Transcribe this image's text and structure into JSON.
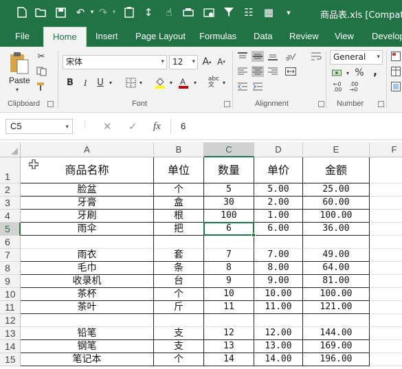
{
  "app": {
    "title": "商品表.xls [Compatibi",
    "accent": "#217346"
  },
  "qat_icons": [
    "new-icon",
    "save-icon",
    "undo-icon",
    "redo-icon",
    "paste-values-icon",
    "format-painter-icon",
    "sort-icon",
    "filter-icon",
    "list-icon",
    "grid-icon",
    "more-icon"
  ],
  "tabs": [
    "File",
    "Home",
    "Insert",
    "Page Layout",
    "Formulas",
    "Data",
    "Review",
    "View",
    "Develop"
  ],
  "ribbon": {
    "clipboard": {
      "label": "Clipboard",
      "paste": "Paste"
    },
    "font": {
      "label": "Font",
      "name": "宋体",
      "size": "12",
      "bold": "B",
      "italic": "I",
      "underline": "U",
      "grow": "A",
      "shrink": "A"
    },
    "alignment": {
      "label": "Alignment"
    },
    "number": {
      "label": "Number",
      "format": "General",
      "percent": "%",
      "comma": ","
    }
  },
  "formula_bar": {
    "name_box": "C5",
    "fx": "fx",
    "cancel": "✕",
    "enter": "✓",
    "value": "6"
  },
  "columns": [
    "A",
    "B",
    "C",
    "D",
    "E",
    "F"
  ],
  "headers": {
    "a": "商品名称",
    "b": "单位",
    "c": "数量",
    "d": "单价",
    "e": "金额"
  },
  "rows": [
    {
      "n": "1"
    },
    {
      "n": "2",
      "a": "脸盆",
      "b": "个",
      "c": "5",
      "d": "5.00",
      "e": "25.00"
    },
    {
      "n": "3",
      "a": "牙膏",
      "b": "盒",
      "c": "30",
      "d": "2.00",
      "e": "60.00"
    },
    {
      "n": "4",
      "a": "牙刷",
      "b": "根",
      "c": "100",
      "d": "1.00",
      "e": "100.00"
    },
    {
      "n": "5",
      "a": "雨伞",
      "b": "把",
      "c": "6",
      "d": "6.00",
      "e": "36.00"
    },
    {
      "n": "6",
      "a": "",
      "b": "",
      "c": "",
      "d": "",
      "e": ""
    },
    {
      "n": "7",
      "a": "雨衣",
      "b": "套",
      "c": "7",
      "d": "7.00",
      "e": "49.00"
    },
    {
      "n": "8",
      "a": "毛巾",
      "b": "条",
      "c": "8",
      "d": "8.00",
      "e": "64.00"
    },
    {
      "n": "9",
      "a": "收录机",
      "b": "台",
      "c": "9",
      "d": "9.00",
      "e": "81.00"
    },
    {
      "n": "10",
      "a": "茶杯",
      "b": "个",
      "c": "10",
      "d": "10.00",
      "e": "100.00"
    },
    {
      "n": "11",
      "a": "茶叶",
      "b": "斤",
      "c": "11",
      "d": "11.00",
      "e": "121.00"
    },
    {
      "n": "12",
      "a": "",
      "b": "",
      "c": "",
      "d": "",
      "e": ""
    },
    {
      "n": "13",
      "a": "铅笔",
      "b": "支",
      "c": "12",
      "d": "12.00",
      "e": "144.00"
    },
    {
      "n": "14",
      "a": "钢笔",
      "b": "支",
      "c": "13",
      "d": "13.00",
      "e": "169.00"
    },
    {
      "n": "15",
      "a": "笔记本",
      "b": "个",
      "c": "14",
      "d": "14.00",
      "e": "196.00"
    }
  ]
}
